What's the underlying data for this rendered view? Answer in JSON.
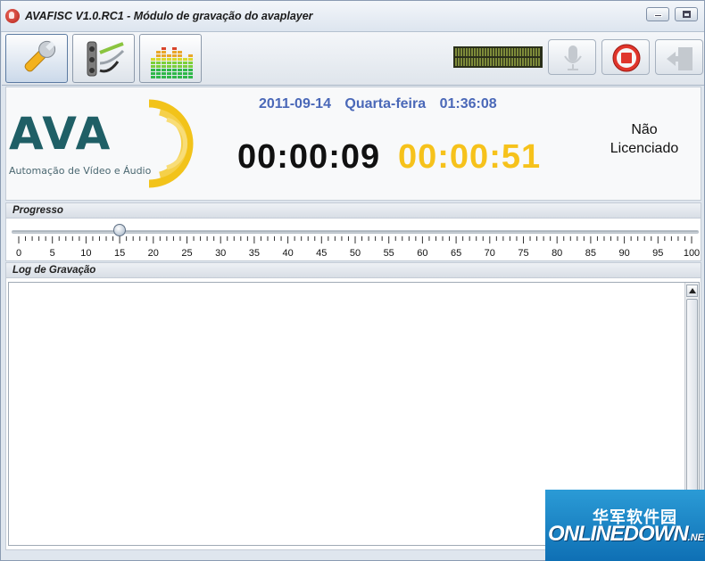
{
  "window": {
    "title": "AVAFISC V1.0.RC1 - Módulo de gravação do avaplayer"
  },
  "toolbar": {
    "buttons": [
      "settings-wrench",
      "audio-cables",
      "equalizer"
    ],
    "right_buttons": [
      "microphone",
      "record-stop",
      "exit"
    ]
  },
  "header": {
    "logo_text": "AVA",
    "logo_subtitle": "Automação de Vídeo e Áudio",
    "date": "2011-09-14",
    "weekday": "Quarta-feira",
    "time": "01:36:08",
    "elapsed": "00:00:09",
    "remaining": "00:00:51",
    "license_line1": "Não",
    "license_line2": "Licenciado"
  },
  "progress": {
    "title": "Progresso",
    "value": 15,
    "min": 0,
    "max": 100,
    "tick_labels": [
      "0",
      "5",
      "10",
      "15",
      "20",
      "25",
      "30",
      "35",
      "40",
      "45",
      "50",
      "55",
      "60",
      "65",
      "70",
      "75",
      "80",
      "85",
      "90",
      "95",
      "100"
    ]
  },
  "log": {
    "title": "Log de Gravação"
  },
  "watermark": {
    "cn_text": "华军软件园",
    "en_text": "ONLINEDOWN",
    "en_suffix": ".NET"
  },
  "colors": {
    "date_blue": "#4a68b8",
    "remaining_yellow": "#f6c21b",
    "logo_teal": "#1f5f66"
  }
}
